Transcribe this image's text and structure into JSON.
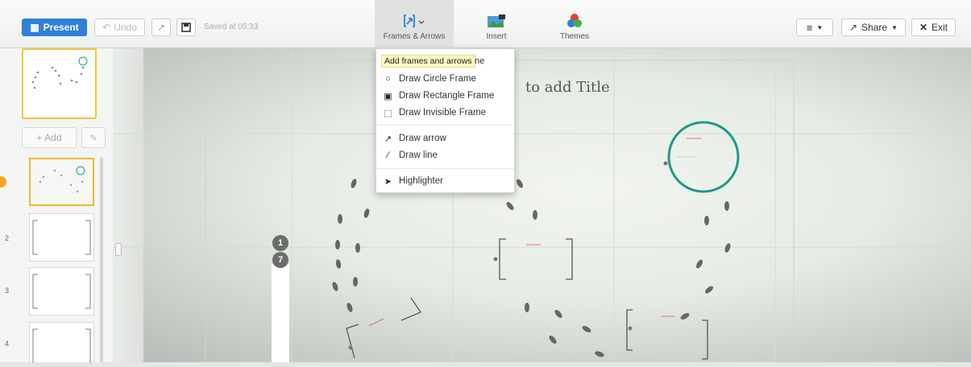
{
  "toolbar": {
    "present_label": "Present",
    "undo_label": "Undo",
    "saved_text": "Saved at 05:33",
    "frames_label": "Frames & Arrows",
    "insert_label": "Insert",
    "themes_label": "Themes",
    "share_label": "Share",
    "exit_label": "Exit"
  },
  "sidebar": {
    "add_label": "+ Add",
    "slides": [
      {
        "num": "2"
      },
      {
        "num": "3"
      },
      {
        "num": "4"
      }
    ]
  },
  "canvas": {
    "title_placeholder": "to add Title",
    "path_numbers": [
      "1",
      "7"
    ]
  },
  "dropdown": {
    "tooltip": "Add frames and arrows",
    "tooltip_tail": "ne",
    "items": [
      {
        "label": "Draw Circle Frame",
        "icon": "circle-icon"
      },
      {
        "label": "Draw Rectangle Frame",
        "icon": "rectangle-icon"
      },
      {
        "label": "Draw Invisible Frame",
        "icon": "dashed-square-icon"
      },
      {
        "label": "Draw arrow",
        "icon": "arrow-icon"
      },
      {
        "label": "Draw line",
        "icon": "line-icon"
      },
      {
        "label": "Highlighter",
        "icon": "highlighter-icon"
      }
    ]
  },
  "colors": {
    "accent": "#2f80d9",
    "active_slide": "#f5b431",
    "circle_frame": "#1c9a8c"
  }
}
